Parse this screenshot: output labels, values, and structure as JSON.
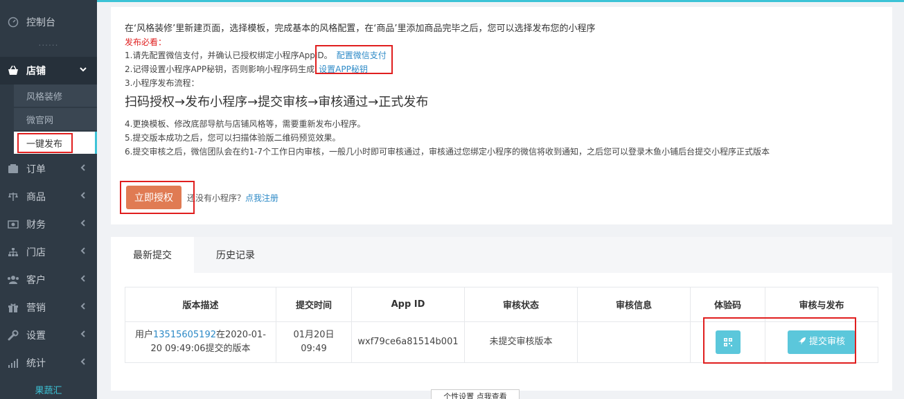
{
  "sidebar": {
    "dashboard": "控制台",
    "dots": "......",
    "shop": "店铺",
    "shop_sub": [
      "风格装修",
      "微官网",
      "一键发布"
    ],
    "orders": "订单",
    "goods": "商品",
    "finance": "财务",
    "stores": "门店",
    "customers": "客户",
    "marketing": "营销",
    "settings": "设置",
    "stats": "统计",
    "brand": "果蔬汇"
  },
  "intro": {
    "text": "在‘风格装修’里新建页面，选择模板，完成基本的风格配置，在‘商品’里添加商品完毕之后，您可以选择发布您的小程序",
    "must_read": "发布必看：",
    "line1": "1.请先配置微信支付，并确认已授权绑定小程序AppID。",
    "line1_link": "配置微信支付",
    "line2": "2.记得设置小程序APP秘钥，否则影响小程序码生成",
    "line2_link": "设置APP秘钥",
    "line3": "3.小程序发布流程：",
    "flow": "扫码授权→发布小程序→提交审核→审核通过→正式发布",
    "line4": "4.更换模板、修改底部导航与店铺风格等，需要重新发布小程序。",
    "line5": "5.提交版本成功之后，您可以扫描体验版二维码预览效果。",
    "line6": "6.提交审核之后，微信团队会在约1-7个工作日内审核，一般几小时即可审核通过，审核通过您绑定小程序的微信将收到通知，之后您可以登录木鱼小铺后台提交小程序正式版本"
  },
  "auth": {
    "button": "立即授权",
    "no_app": "还没有小程序？",
    "register_link": "点我注册"
  },
  "tabs": [
    "最新提交",
    "历史记录"
  ],
  "table": {
    "headers": [
      "版本描述",
      "提交时间",
      "App ID",
      "审核状态",
      "审核信息",
      "体验码",
      "审核与发布"
    ],
    "row": {
      "desc_prefix": "用户",
      "desc_phone": "13515605192",
      "desc_suffix": "在2020-01-20 09:49:06提交的版本",
      "time": "01月20日 09:49",
      "appid": "wxf79ce6a81514b001",
      "status": "未提交审核版本",
      "info": "",
      "submit_btn": "提交审核"
    }
  },
  "tooltip": "个性设置 点我查看",
  "colors": {
    "accent": "#3cc3d6",
    "sidebar_bg": "#2f3a45",
    "auth_button": "#e07b53",
    "teal_button": "#5bc7db",
    "highlight_red": "#e01e1e",
    "warning_red": "#e02020",
    "link_blue": "#2d8ac7"
  },
  "icons": {
    "dashboard": "gauge-icon",
    "shop": "basket-icon",
    "orders": "orders-icon",
    "goods": "scale-icon",
    "finance": "money-icon",
    "stores": "sitemap-icon",
    "customers": "users-icon",
    "marketing": "gift-icon",
    "settings": "wrench-icon",
    "stats": "bar-chart-icon",
    "qr": "qrcode-icon",
    "rocket": "rocket-icon"
  }
}
